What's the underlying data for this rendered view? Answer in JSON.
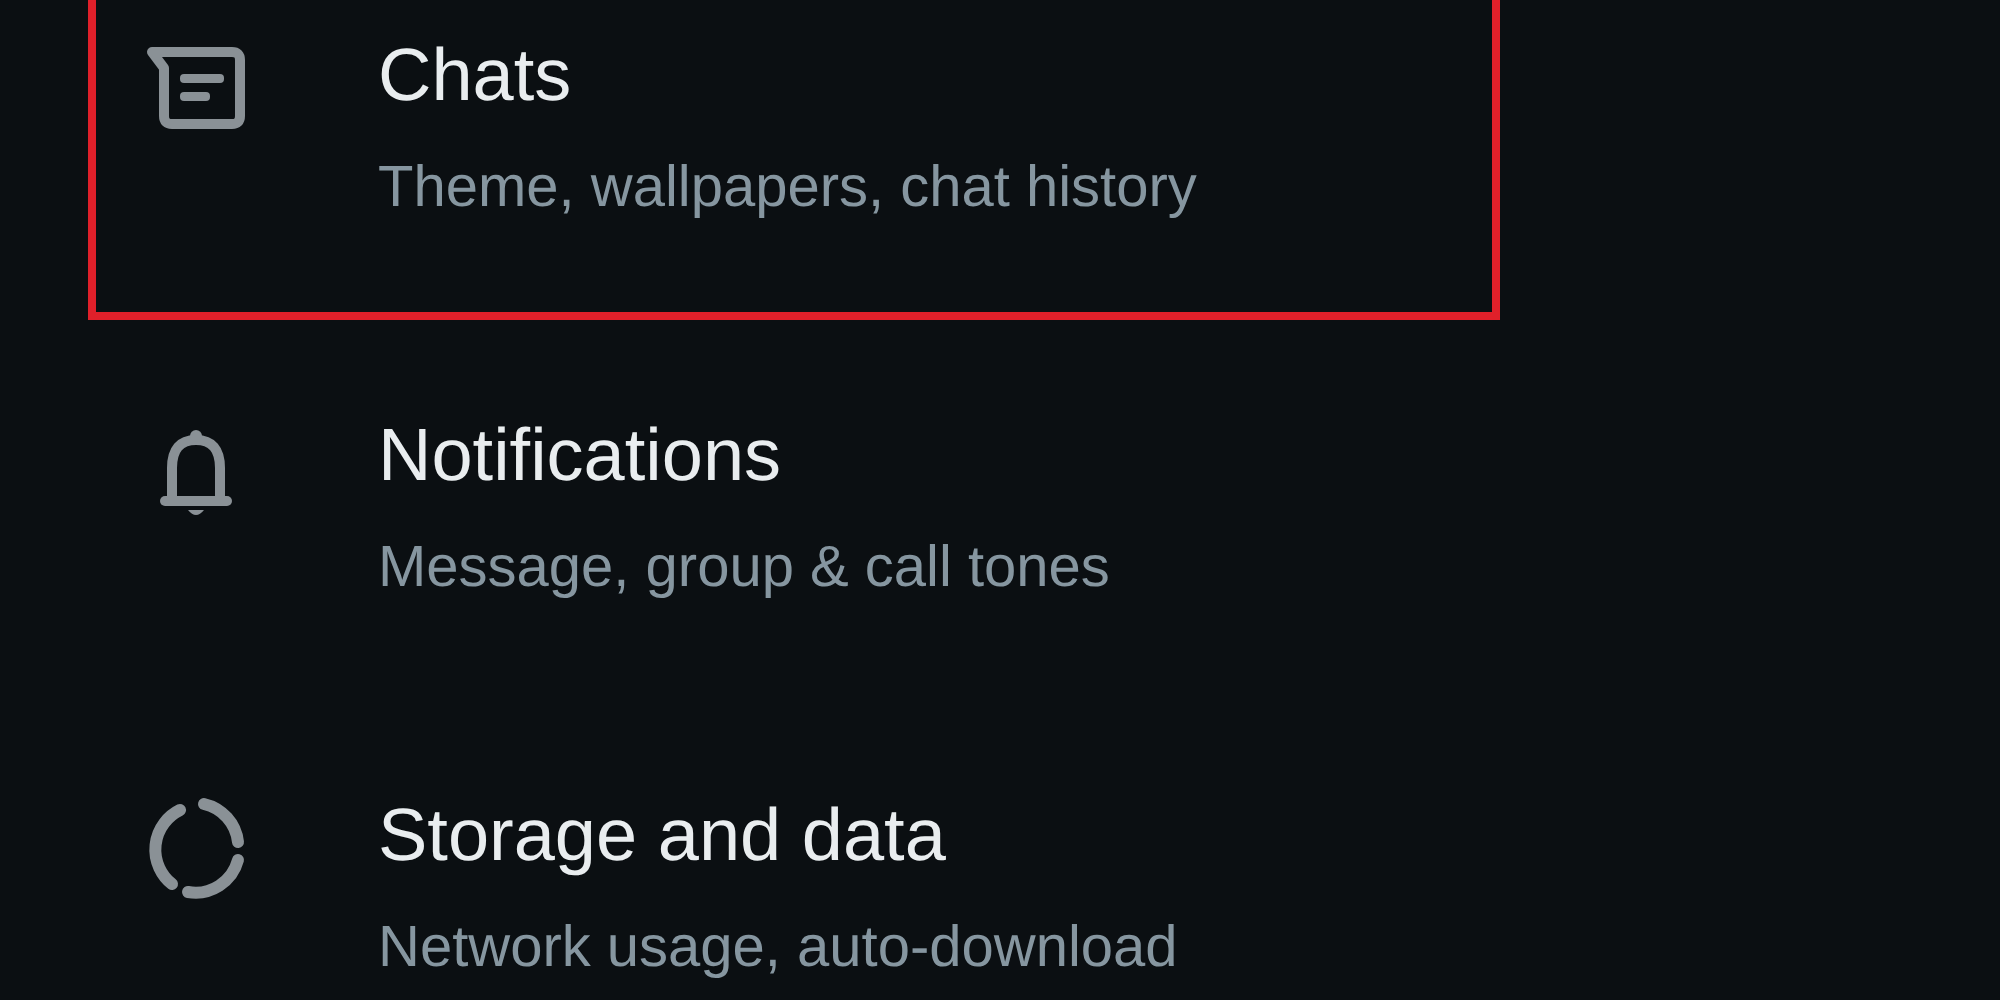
{
  "items": [
    {
      "kind": "chat",
      "title": "Chats",
      "subtitle": "Theme, wallpapers, chat history",
      "highlighted": true
    },
    {
      "kind": "bell",
      "title": "Notifications",
      "subtitle": "Message, group & call tones",
      "highlighted": false
    },
    {
      "kind": "ring",
      "title": "Storage and data",
      "subtitle": "Network usage, auto-download",
      "highlighted": false
    }
  ]
}
